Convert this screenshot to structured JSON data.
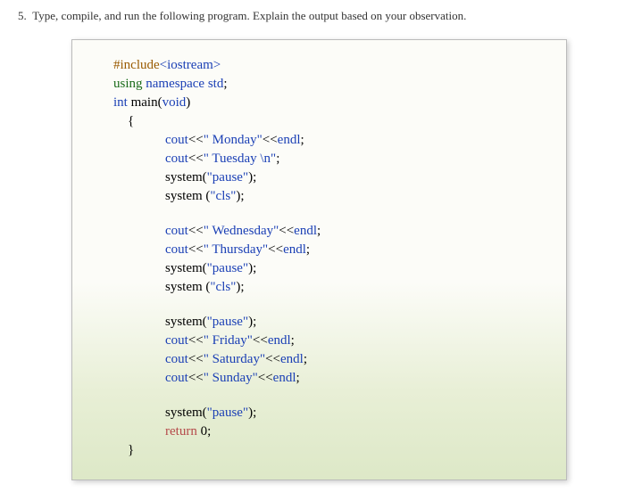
{
  "question": {
    "number": "5.",
    "text": "Type, compile, and run the following program. Explain the output based on your observation."
  },
  "code": {
    "l1_pre": "#include",
    "l1_ang_open": "<",
    "l1_header": "iostream",
    "l1_ang_close": ">",
    "l2_using": "using ",
    "l2_namespace": "namespace ",
    "l2_std": "std",
    "l2_semi": ";",
    "l3_int": "int ",
    "l3_main": "main(",
    "l3_void": "void",
    "l3_close": ")",
    "l4_brace": "{",
    "l5_cout": "cout",
    "l5_op1": "<<",
    "l5_str": "\" Monday\"",
    "l5_op2": "<<",
    "l5_endl": "endl",
    "l5_semi": ";",
    "l6_cout": "cout",
    "l6_op1": "<<",
    "l6_str": "\" Tuesday \\n\"",
    "l6_semi": ";",
    "l7_sys": "system(",
    "l7_str": "\"pause\"",
    "l7_close": ");",
    "l8_sys": "system (",
    "l8_str": "\"cls\"",
    "l8_close": ");",
    "l9_cout": "cout",
    "l9_op1": "<<",
    "l9_str": "\" Wednesday\"",
    "l9_op2": "<<",
    "l9_endl": "endl",
    "l9_semi": ";",
    "l10_cout": "cout",
    "l10_op1": "<<",
    "l10_str": "\" Thursday\"",
    "l10_op2": "<<",
    "l10_endl": "endl",
    "l10_semi": ";",
    "l11_sys": "system(",
    "l11_str": "\"pause\"",
    "l11_close": ");",
    "l12_sys": "system (",
    "l12_str": "\"cls\"",
    "l12_close": ");",
    "l13_sys": "system(",
    "l13_str": "\"pause\"",
    "l13_close": ");",
    "l14_cout": "cout",
    "l14_op1": "<<",
    "l14_str": "\" Friday\"",
    "l14_op2": "<<",
    "l14_endl": "endl",
    "l14_semi": ";",
    "l15_cout": "cout",
    "l15_op1": "<<",
    "l15_str": "\" Saturday\"",
    "l15_op2": "<<",
    "l15_endl": "endl",
    "l15_semi": ";",
    "l16_cout": "cout",
    "l16_op1": "<<",
    "l16_str": "\" Sunday\"",
    "l16_op2": "<<",
    "l16_endl": "endl",
    "l16_semi": ";",
    "l17_sys": "system(",
    "l17_str": "\"pause\"",
    "l17_close": ");",
    "l18_return": "return ",
    "l18_zero": "0",
    "l18_semi": ";",
    "l19_brace": "}"
  }
}
